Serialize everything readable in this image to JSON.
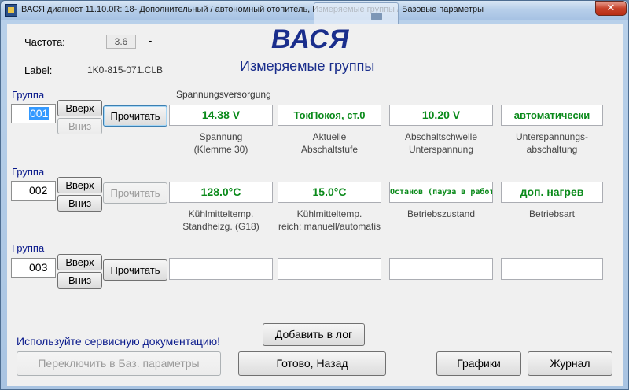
{
  "window": {
    "title": "ВАСЯ диагност 11.10.0R: 18- Дополнительный / автономный отопитель,  Измеряемые группы / Базовые параметры",
    "close_label": "✕"
  },
  "header": {
    "freq_label": "Частота:",
    "freq_value": "3.6",
    "freq_suffix": "-",
    "label_caption": "Label:",
    "label_value": "1K0-815-071.CLB",
    "brand": "ВАСЯ",
    "subtitle": "Измеряемые группы"
  },
  "group1": {
    "label": "Группа",
    "number": "001",
    "up": "Вверх",
    "down": "Вниз",
    "read": "Прочитать",
    "group_title": "Spannungsversorgung",
    "values": [
      "14.38 V",
      "ТокПокоя, ст.0",
      "10.20 V",
      "автоматически"
    ],
    "captions": [
      [
        "Spannung",
        "(Klemme 30)"
      ],
      [
        "Aktuelle",
        "Abschaltstufe"
      ],
      [
        "Abschaltschwelle",
        "Unterspannung"
      ],
      [
        "Unterspannungs-",
        "abschaltung"
      ]
    ]
  },
  "group2": {
    "label": "Группа",
    "number": "002",
    "up": "Вверх",
    "down": "Вниз",
    "read": "Прочитать",
    "values": [
      "128.0°C",
      "15.0°C",
      "Останов (пауза в работе",
      "доп. нагрев"
    ],
    "captions": [
      [
        "Kühlmitteltemp.",
        "Standheizg. (G18)"
      ],
      [
        "Kühlmitteltemp.",
        "reich: manuell/automatis"
      ],
      [
        "Betriebszustand",
        ""
      ],
      [
        "Betriebsart",
        ""
      ]
    ]
  },
  "group3": {
    "label": "Группа",
    "number": "003",
    "up": "Вверх",
    "down": "Вниз",
    "read": "Прочитать",
    "values": [
      "",
      "",
      "",
      ""
    ]
  },
  "footer": {
    "doc_hint": "Используйте сервисную документацию!",
    "add_log": "Добавить в лог",
    "switch_basic": "Переключить в Баз. параметры",
    "done_back": "Готово, Назад",
    "graphs": "Графики",
    "journal": "Журнал"
  },
  "colors": {
    "value_text": "#0a8a1a",
    "brand": "#1a2e8c",
    "label_blue": "#0a1a8c",
    "selection": "#3399ff"
  }
}
